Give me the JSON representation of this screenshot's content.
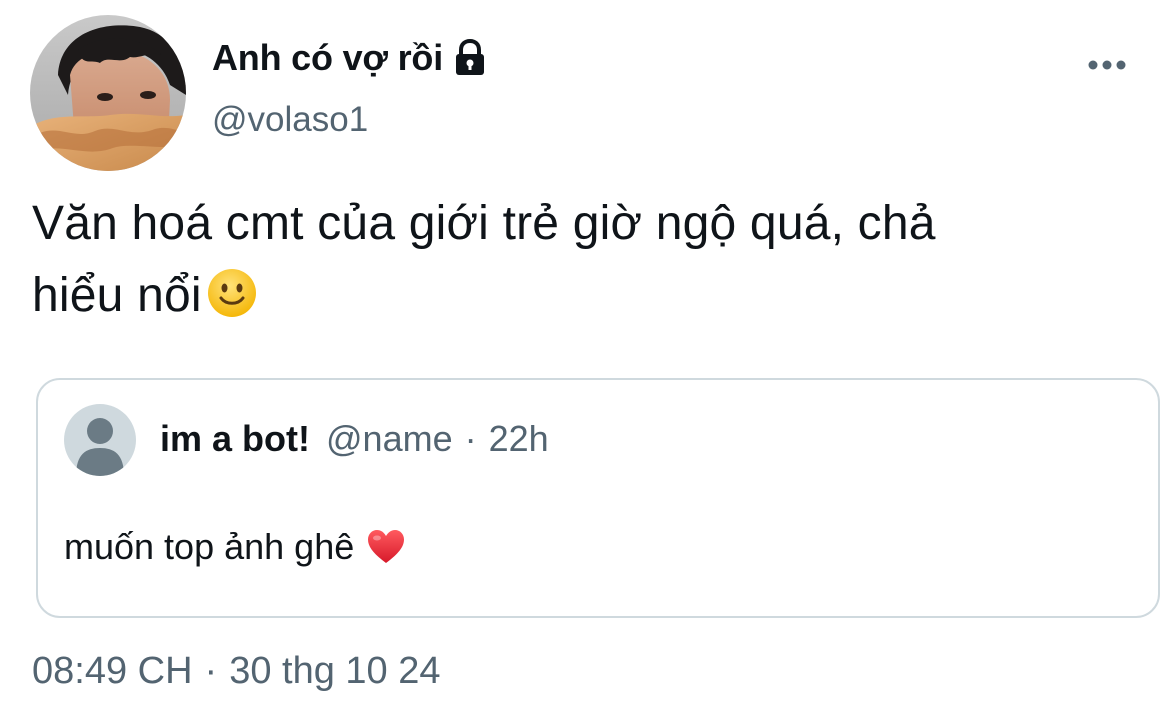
{
  "author": {
    "display_name": "Anh có vợ rồi",
    "handle": "@volaso1",
    "avatar_icon": "profile-photo",
    "protected_icon": "lock-icon"
  },
  "menu": {
    "more_icon": "more-horizontal-icon"
  },
  "tweet": {
    "line1": "Văn hoá cmt của giới trẻ giờ ngộ quá, chả",
    "line2": "hiểu nổi",
    "emoji": "slightly-smiling-face"
  },
  "quoted": {
    "name": "im a bot!",
    "handle": "@name",
    "separator": "·",
    "time": "22h",
    "text": "muốn top ảnh ghê",
    "emoji": "red-heart",
    "avatar_icon": "default-profile-icon"
  },
  "meta": {
    "time": "08:49 CH",
    "separator": "·",
    "date": "30 thg 10 24"
  },
  "colors": {
    "primary_text": "#0f1419",
    "secondary_text": "#536471",
    "card_border": "#cfd9de"
  }
}
